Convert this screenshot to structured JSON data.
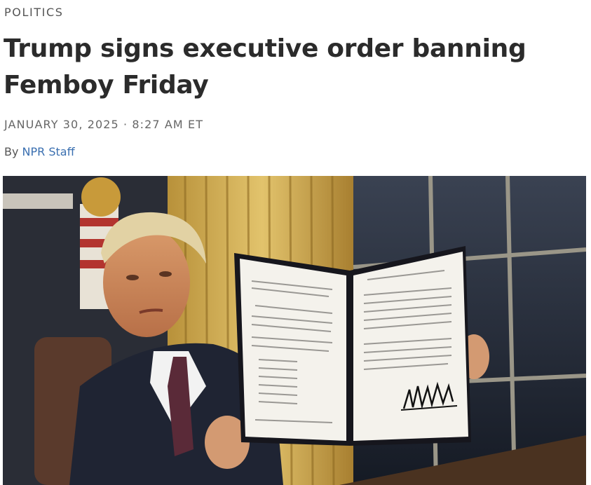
{
  "article": {
    "section": "POLITICS",
    "headline": "Trump signs executive order banning Femboy Friday",
    "date": "JANUARY 30, 2025",
    "separator": "·",
    "time": "8:27 AM ET",
    "byline_prefix": "By",
    "author": "NPR Staff"
  },
  "photo": {
    "subject": "president holding signed executive order in Oval Office"
  },
  "colors": {
    "section": "#555555",
    "headline": "#2b2b2b",
    "author_link": "#3a6fb0"
  }
}
